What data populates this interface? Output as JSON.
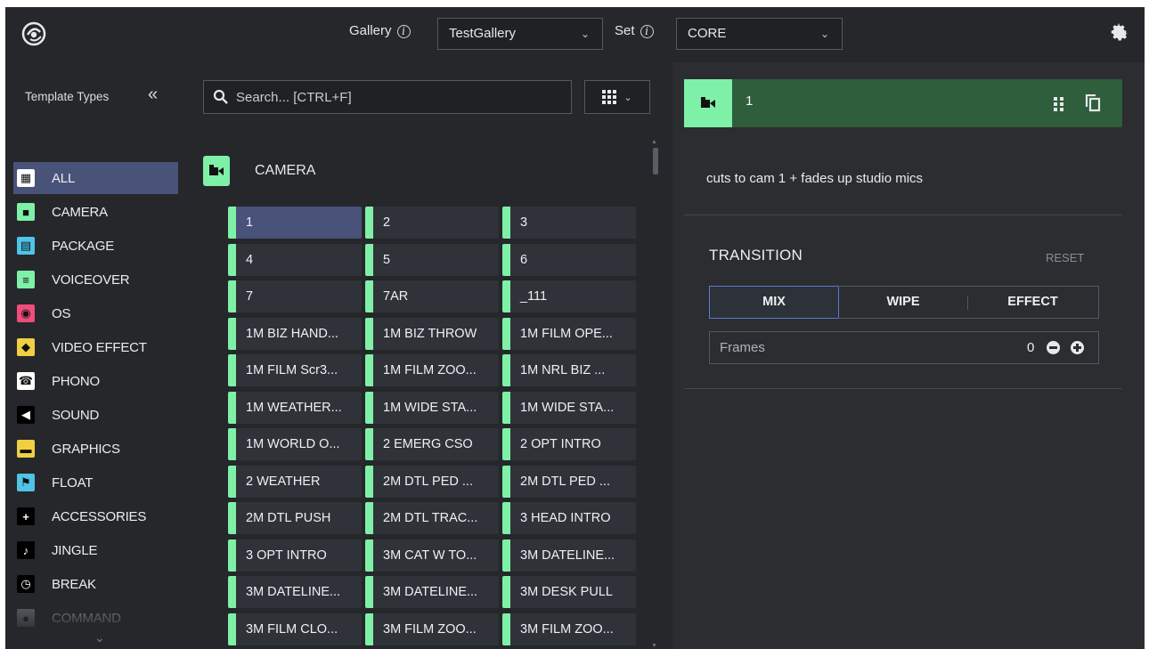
{
  "header": {
    "gallery_label": "Gallery",
    "gallery_value": "TestGallery",
    "set_label": "Set",
    "set_value": "CORE"
  },
  "left_panel": {
    "title": "Template Types",
    "collapse_glyph": "«",
    "items": [
      {
        "label": "ALL",
        "color": "#ffffff",
        "icon": "grid-icon",
        "active": true
      },
      {
        "label": "CAMERA",
        "color": "#7ff0a7",
        "icon": "camera-icon"
      },
      {
        "label": "PACKAGE",
        "color": "#4fc3e8",
        "icon": "film-icon"
      },
      {
        "label": "VOICEOVER",
        "color": "#7ff0a7",
        "icon": "voiceover-icon"
      },
      {
        "label": "OS",
        "color": "#f04d7a",
        "icon": "record-icon"
      },
      {
        "label": "VIDEO EFFECT",
        "color": "#f0d040",
        "icon": "video-effect-icon"
      },
      {
        "label": "PHONO",
        "color": "#ffffff",
        "icon": "phone-icon"
      },
      {
        "label": "SOUND",
        "color": "#ffffff",
        "icon": "speaker-icon"
      },
      {
        "label": "GRAPHICS",
        "color": "#f0d040",
        "icon": "graphics-icon"
      },
      {
        "label": "FLOAT",
        "color": "#4fc3e8",
        "icon": "flag-icon"
      },
      {
        "label": "ACCESSORIES",
        "color": "#ffffff",
        "icon": "plus-icon"
      },
      {
        "label": "JINGLE",
        "color": "#ffffff",
        "icon": "jingle-icon"
      },
      {
        "label": "BREAK",
        "color": "#ffffff",
        "icon": "clock-icon"
      },
      {
        "label": "COMMAND",
        "color": "#9aa0a8",
        "icon": "command-icon"
      }
    ]
  },
  "search": {
    "placeholder": "Search... [CTRL+F]"
  },
  "section": {
    "label": "CAMERA"
  },
  "tiles": [
    "1",
    "2",
    "3",
    "4",
    "5",
    "6",
    "7",
    "7AR",
    "_111",
    "1M BIZ HAND...",
    "1M BIZ THROW",
    "1M FILM OPE...",
    "1M FILM Scr3...",
    "1M FILM ZOO...",
    "1M NRL BIZ ...",
    "1M WEATHER...",
    "1M WIDE STA...",
    "1M WIDE STA...",
    "1M WORLD O...",
    "2 EMERG CSO",
    "2 OPT INTRO",
    "2 WEATHER",
    "2M DTL PED ...",
    "2M DTL PED ...",
    "2M DTL PUSH",
    "2M DTL TRAC...",
    "3 HEAD INTRO",
    "3 OPT INTRO",
    "3M CAT W TO...",
    "3M DATELINE...",
    "3M DATELINE...",
    "3M DATELINE...",
    "3M DESK PULL",
    "3M FILM CLO...",
    "3M FILM ZOO...",
    "3M FILM ZOO..."
  ],
  "detail": {
    "number": "1",
    "description": "cuts to cam 1 + fades up studio mics",
    "transition_title": "TRANSITION",
    "reset_label": "RESET",
    "modes": [
      "MIX",
      "WIPE",
      "EFFECT"
    ],
    "active_mode": "MIX",
    "frames_label": "Frames",
    "frames_value": "0"
  },
  "colors": {
    "camera_green": "#7ff0a7",
    "detail_bar_green": "#2e5e3b",
    "selection_blue": "#495279"
  }
}
